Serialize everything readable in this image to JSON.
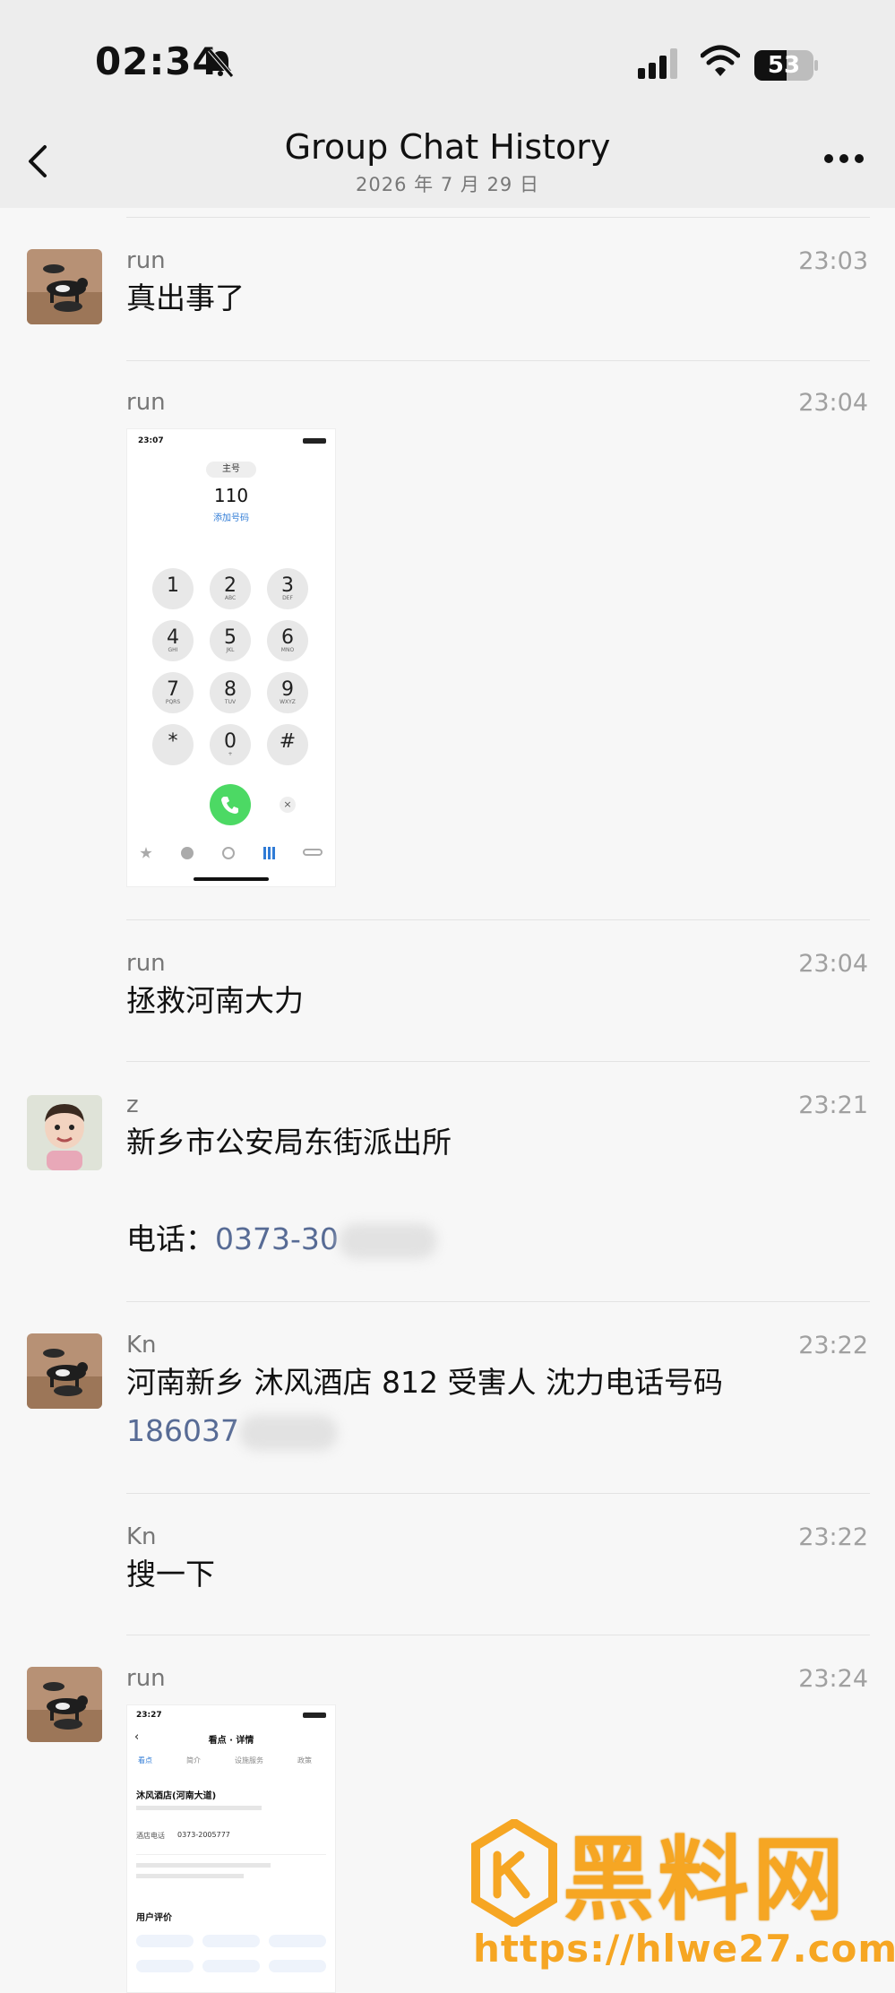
{
  "status_bar": {
    "time": "02:34",
    "battery": "53"
  },
  "nav": {
    "title": "Group Chat History",
    "subtitle": "2026 年 7 月 29 日"
  },
  "messages": [
    {
      "sender": "run",
      "time": "23:03",
      "text": "真出事了"
    },
    {
      "sender": "run",
      "time": "23:04",
      "image": "dialer-screenshot"
    },
    {
      "sender": "run",
      "time": "23:04",
      "text": "拯救河南大力"
    },
    {
      "sender": "z",
      "time": "23:21",
      "text": "新乡市公安局东街派出所",
      "phone_label": "电话：",
      "phone": "0373-30"
    },
    {
      "sender": "Kn",
      "time": "23:22",
      "text": "河南新乡 沐风酒店 812 受害人 沈力电话号码",
      "phone": "186037"
    },
    {
      "sender": "Kn",
      "time": "23:22",
      "text": "搜一下"
    },
    {
      "sender": "run",
      "time": "23:24",
      "image": "hotel-screenshot"
    }
  ],
  "dialer": {
    "clock": "23:07",
    "line": "主号",
    "number": "110",
    "add": "添加号码",
    "keys": [
      {
        "d": "1",
        "l": ""
      },
      {
        "d": "2",
        "l": "ABC"
      },
      {
        "d": "3",
        "l": "DEF"
      },
      {
        "d": "4",
        "l": "GHI"
      },
      {
        "d": "5",
        "l": "JKL"
      },
      {
        "d": "6",
        "l": "MNO"
      },
      {
        "d": "7",
        "l": "PQRS"
      },
      {
        "d": "8",
        "l": "TUV"
      },
      {
        "d": "9",
        "l": "WXYZ"
      },
      {
        "d": "*",
        "l": ""
      },
      {
        "d": "0",
        "l": "+"
      },
      {
        "d": "#",
        "l": ""
      }
    ]
  },
  "hotel": {
    "clock": "23:27",
    "header": "看点 · 详情",
    "tabs": [
      "看点",
      "简介",
      "设施服务",
      "政策"
    ],
    "name": "沐风酒店(河南大道)",
    "phone_label": "酒店电话",
    "phone": "0373-2005777",
    "reviews": "用户评价"
  },
  "watermark": {
    "brand": "黑料网",
    "url": "https://hlwe27.com"
  },
  "colors": {
    "link": "#576b95",
    "watermark": "#f6a623",
    "call_green": "#4cd964"
  }
}
